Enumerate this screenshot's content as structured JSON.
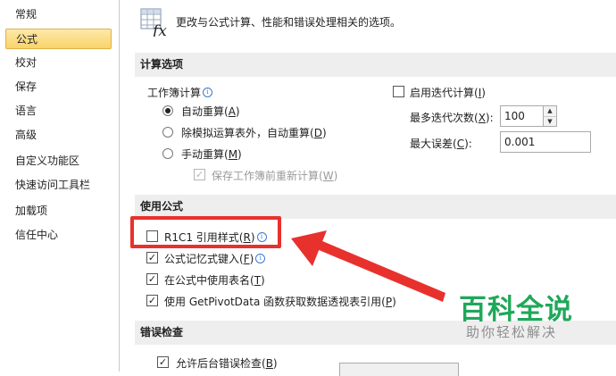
{
  "sidebar": {
    "items": [
      {
        "label": "常规",
        "active": false
      },
      {
        "label": "公式",
        "active": true
      },
      {
        "label": "校对",
        "active": false
      },
      {
        "label": "保存",
        "active": false
      },
      {
        "label": "语言",
        "active": false
      },
      {
        "label": "高级",
        "active": false
      },
      {
        "label": "自定义功能区",
        "active": false
      },
      {
        "label": "快速访问工具栏",
        "active": false
      },
      {
        "label": "加载项",
        "active": false
      },
      {
        "label": "信任中心",
        "active": false
      }
    ]
  },
  "header": {
    "icon": "formula-fx-icon",
    "text": "更改与公式计算、性能和错误处理相关的选项。"
  },
  "calc": {
    "title": "计算选项",
    "workbook_calc": "工作簿计算",
    "info": "i",
    "auto": {
      "label": "自动重算(",
      "key": "A",
      "end": ")",
      "selected": true
    },
    "auto_except": {
      "label": "除模拟运算表外，自动重算(",
      "key": "D",
      "end": ")",
      "selected": false
    },
    "manual": {
      "label": "手动重算(",
      "key": "M",
      "end": ")",
      "selected": false
    },
    "recalc_before_save": {
      "label": "保存工作簿前重新计算(",
      "key": "W",
      "end": ")",
      "checked": true,
      "disabled": true
    },
    "iterative": {
      "label": "启用迭代计算(",
      "key": "I",
      "end": ")",
      "checked": false
    },
    "max_iter_label": "最多迭代次数(",
    "max_iter_key": "X",
    "max_iter_end": "):",
    "max_iter_value": "100",
    "max_change_label": "最大误差(",
    "max_change_key": "C",
    "max_change_end": "):",
    "max_change_value": "0.001"
  },
  "formulas": {
    "title": "使用公式",
    "r1c1": {
      "label": "R1C1 引用样式(",
      "key": "R",
      "end": ")",
      "checked": false
    },
    "autocomplete": {
      "label": "公式记忆式键入(",
      "key": "F",
      "end": ")",
      "checked": true
    },
    "table_names": {
      "label": "在公式中使用表名(",
      "key": "T",
      "end": ")",
      "checked": true
    },
    "getpivot": {
      "label": "使用 GetPivotData 函数获取数据透视表引用(",
      "key": "P",
      "end": ")",
      "checked": true
    }
  },
  "errors": {
    "title": "错误检查",
    "bg_check": {
      "label": "允许后台错误检查(",
      "key": "B",
      "end": ")",
      "checked": true
    }
  },
  "watermark": {
    "title": "百科全说",
    "subtitle": "助你轻松解决"
  },
  "colors": {
    "annotation": "#e8312d",
    "watermark": "#1fa85a",
    "active_item": "#f9d46a"
  }
}
